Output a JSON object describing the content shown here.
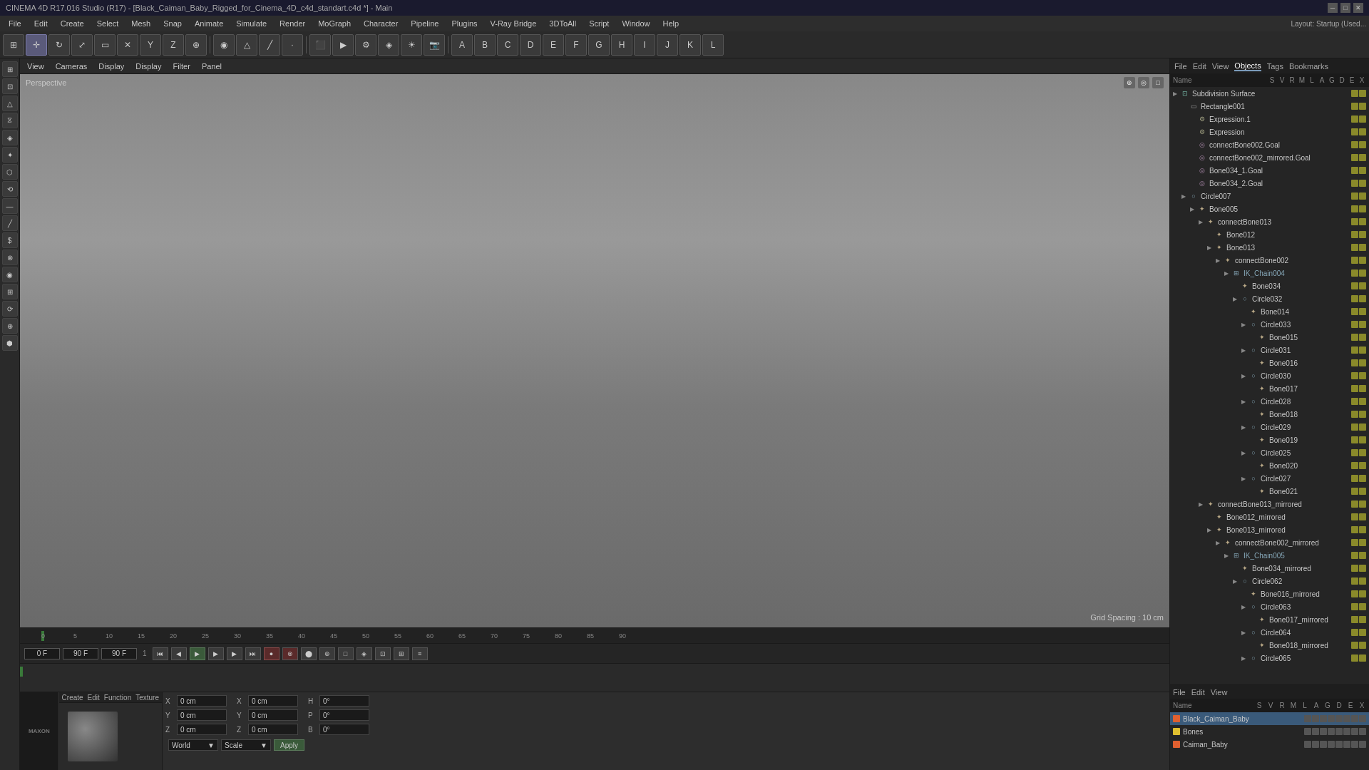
{
  "titlebar": {
    "title": "CINEMA 4D R17.016 Studio (R17) - [Black_Caiman_Baby_Rigged_for_Cinema_4D_c4d_standart.c4d *] - Main",
    "min": "─",
    "max": "□",
    "close": "✕"
  },
  "menubar": {
    "items": [
      "File",
      "Edit",
      "Create",
      "Select",
      "Mesh",
      "Snap",
      "Animate",
      "Simulate",
      "Render",
      "MoGraph",
      "Character",
      "Pipeline",
      "Plugins",
      "V-Ray Bridge",
      "3DToAll",
      "Script",
      "Window",
      "Help"
    ]
  },
  "viewport": {
    "label": "Perspective",
    "grid_spacing": "Grid Spacing : 10 cm",
    "tabs": [
      "View",
      "Cameras",
      "Display",
      "Display",
      "Filter",
      "Panel"
    ]
  },
  "timeline": {
    "marks": [
      "0",
      "5",
      "10",
      "15",
      "20",
      "25",
      "30",
      "35",
      "40",
      "45",
      "50",
      "55",
      "60",
      "65",
      "70",
      "75",
      "80",
      "85",
      "90"
    ],
    "frame_start": "0 F",
    "frame_end": "90 F",
    "current_frame": "0 F",
    "max_frames": "90 F"
  },
  "object_manager": {
    "tabs": [
      "File",
      "Edit",
      "View",
      "Objects",
      "Tags",
      "Bookmarks"
    ],
    "active_tab": "Objects",
    "columns": [
      "Name",
      "S",
      "V",
      "R",
      "M",
      "L",
      "A",
      "G",
      "D",
      "E",
      "X"
    ],
    "items": [
      {
        "name": "Subdivision Surface",
        "level": 0,
        "has_arrow": true,
        "type": "subdiv"
      },
      {
        "name": "Rectangle001",
        "level": 1,
        "has_arrow": false,
        "type": "rect"
      },
      {
        "name": "Expression.1",
        "level": 2,
        "has_arrow": false,
        "type": "expr"
      },
      {
        "name": "Expression",
        "level": 2,
        "has_arrow": false,
        "type": "expr"
      },
      {
        "name": "connectBone002.Goal",
        "level": 2,
        "has_arrow": false,
        "type": "goal"
      },
      {
        "name": "connectBone002_mirrored.Goal",
        "level": 2,
        "has_arrow": false,
        "type": "goal"
      },
      {
        "name": "Bone034_1.Goal",
        "level": 2,
        "has_arrow": false,
        "type": "goal"
      },
      {
        "name": "Bone034_2.Goal",
        "level": 2,
        "has_arrow": false,
        "type": "goal"
      },
      {
        "name": "Circle007",
        "level": 1,
        "has_arrow": true,
        "type": "circle"
      },
      {
        "name": "Bone005",
        "level": 2,
        "has_arrow": true,
        "type": "bone"
      },
      {
        "name": "connectBone013",
        "level": 3,
        "has_arrow": true,
        "type": "bone"
      },
      {
        "name": "Bone012",
        "level": 4,
        "has_arrow": false,
        "type": "bone"
      },
      {
        "name": "Bone013",
        "level": 4,
        "has_arrow": true,
        "type": "bone"
      },
      {
        "name": "connectBone002",
        "level": 5,
        "has_arrow": true,
        "type": "bone"
      },
      {
        "name": "IK_Chain004",
        "level": 6,
        "has_arrow": true,
        "type": "ik",
        "chain": true
      },
      {
        "name": "Bone034",
        "level": 7,
        "has_arrow": false,
        "type": "bone"
      },
      {
        "name": "Circle032",
        "level": 7,
        "has_arrow": true,
        "type": "circle"
      },
      {
        "name": "Bone014",
        "level": 8,
        "has_arrow": false,
        "type": "bone"
      },
      {
        "name": "Circle033",
        "level": 8,
        "has_arrow": true,
        "type": "circle"
      },
      {
        "name": "Bone015",
        "level": 9,
        "has_arrow": false,
        "type": "bone"
      },
      {
        "name": "Circle031",
        "level": 8,
        "has_arrow": true,
        "type": "circle"
      },
      {
        "name": "Bone016",
        "level": 9,
        "has_arrow": false,
        "type": "bone"
      },
      {
        "name": "Circle030",
        "level": 8,
        "has_arrow": true,
        "type": "circle"
      },
      {
        "name": "Bone017",
        "level": 9,
        "has_arrow": false,
        "type": "bone"
      },
      {
        "name": "Circle028",
        "level": 8,
        "has_arrow": true,
        "type": "circle"
      },
      {
        "name": "Bone018",
        "level": 9,
        "has_arrow": false,
        "type": "bone"
      },
      {
        "name": "Circle029",
        "level": 8,
        "has_arrow": true,
        "type": "circle"
      },
      {
        "name": "Bone019",
        "level": 9,
        "has_arrow": false,
        "type": "bone"
      },
      {
        "name": "Circle025",
        "level": 8,
        "has_arrow": true,
        "type": "circle"
      },
      {
        "name": "Bone020",
        "level": 9,
        "has_arrow": false,
        "type": "bone"
      },
      {
        "name": "Circle027",
        "level": 8,
        "has_arrow": true,
        "type": "circle"
      },
      {
        "name": "Bone021",
        "level": 9,
        "has_arrow": false,
        "type": "bone"
      },
      {
        "name": "connectBone013_mirrored",
        "level": 3,
        "has_arrow": true,
        "type": "bone"
      },
      {
        "name": "Bone012_mirrored",
        "level": 4,
        "has_arrow": false,
        "type": "bone"
      },
      {
        "name": "Bone013_mirrored",
        "level": 4,
        "has_arrow": true,
        "type": "bone"
      },
      {
        "name": "connectBone002_mirrored",
        "level": 5,
        "has_arrow": true,
        "type": "bone"
      },
      {
        "name": "IK_Chain005",
        "level": 6,
        "has_arrow": true,
        "type": "ik",
        "chain": true
      },
      {
        "name": "Bone034_mirrored",
        "level": 7,
        "has_arrow": false,
        "type": "bone"
      },
      {
        "name": "Circle062",
        "level": 7,
        "has_arrow": true,
        "type": "circle"
      },
      {
        "name": "Bone016_mirrored",
        "level": 8,
        "has_arrow": false,
        "type": "bone"
      },
      {
        "name": "Circle063",
        "level": 8,
        "has_arrow": true,
        "type": "circle"
      },
      {
        "name": "Bone017_mirrored",
        "level": 9,
        "has_arrow": false,
        "type": "bone"
      },
      {
        "name": "Circle064",
        "level": 8,
        "has_arrow": true,
        "type": "circle"
      },
      {
        "name": "Bone018_mirrored",
        "level": 9,
        "has_arrow": false,
        "type": "bone"
      },
      {
        "name": "Circle065",
        "level": 8,
        "has_arrow": true,
        "type": "circle"
      }
    ]
  },
  "bottom_manager": {
    "tabs": [
      "File",
      "Edit",
      "View"
    ],
    "columns": [
      "Name",
      "S",
      "V",
      "R",
      "M",
      "L",
      "A",
      "G",
      "D",
      "E",
      "X"
    ],
    "items": [
      {
        "name": "Black_Caiman_Baby",
        "color": "#e06030",
        "selected": true
      },
      {
        "name": "Bones",
        "color": "#e0c030"
      },
      {
        "name": "Caiman_Baby",
        "color": "#e06030"
      }
    ]
  },
  "coordinates": {
    "x_val": "0 cm",
    "y_val": "0 cm",
    "z_val": "0 cm",
    "x_rot": "0°",
    "y_rot": "0°",
    "z_rot": "0°",
    "h_val": "0°",
    "p_val": "0°",
    "b_val": "0°",
    "world_label": "World",
    "scale_label": "Scale",
    "apply_label": "Apply"
  },
  "layout": {
    "label": "Layout:",
    "value": "Startup (Used..."
  },
  "icons": {
    "arrow_right": "▶",
    "arrow_down": "▼",
    "circle": "○",
    "bone": "✦",
    "ik": "⊞",
    "subdiv": "⊡",
    "play": "▶",
    "stop": "■",
    "rewind": "◀◀",
    "forward": "▶▶",
    "record": "●"
  }
}
